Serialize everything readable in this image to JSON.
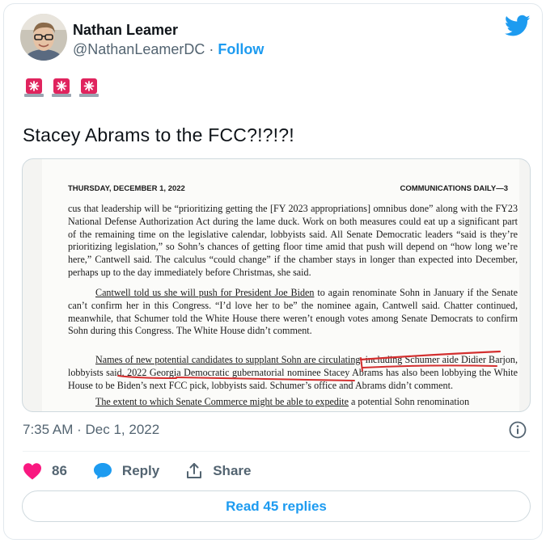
{
  "author": {
    "name": "Nathan Leamer",
    "handle": "@NathanLeamerDC",
    "separator": "·",
    "follow_label": "Follow"
  },
  "tweet": {
    "emoji": [
      "police-car-light",
      "police-car-light",
      "police-car-light"
    ],
    "text": "Stacey Abrams to the FCC?!?!?!"
  },
  "document": {
    "header_left": "THURSDAY, DECEMBER 1, 2022",
    "header_right": "COMMUNICATIONS DAILY—3",
    "p1": "cus that leadership will be “prioritizing getting the [FY 2023 appropriations] omnibus done” along with the FY23 National Defense Authorization Act during the lame duck. Work on both measures could eat up a significant part of the remaining time on the legislative calendar, lobbyists said. All Senate Democratic leaders “said is they’re prioritizing legislation,” so Sohn’s chances of getting floor time amid that push will depend on “how long we’re here,” Cantwell said. The calculus “could change” if the chamber stays in longer than expected into December, perhaps up to the day immediately before Christmas, she said.",
    "p2_underlined": "Cantwell told us she will push for President Joe Biden",
    "p2_rest": " to again renominate Sohn in January if the Senate can’t confirm her in this Congress. “I’d love her to be” the nominee again, Cantwell said. Chatter continued, meanwhile, that Schumer told the White House there weren’t enough votes among Senate Democrats to confirm Sohn during this Congress. The White House didn’t comment.",
    "p3_underlined": "Names of new potential candidates to supplant Sohn are circulating",
    "p3_rest": ", including Schumer aide Didier Barjon, lobbyists said. 2022 Georgia Democratic gubernatorial nominee Stacey Abrams has also been lobbying the White House to be Biden’s next FCC pick, lobbyists said. Schumer’s office and Abrams didn’t comment.",
    "p4_underlined": "The extent to which Senate Commerce might be able to expedite",
    "p4_rest": " a potential Sohn renomination"
  },
  "meta": {
    "time": "7:35 AM",
    "separator": "·",
    "date": "Dec 1, 2022"
  },
  "actions": {
    "like_count": "86",
    "reply_label": "Reply",
    "share_label": "Share"
  },
  "read_replies_label": "Read 45 replies",
  "colors": {
    "accent": "#1d9bf0",
    "like": "#f91880",
    "muted": "#536471",
    "siren": "#e0245e",
    "annotation": "#d32f2f"
  }
}
